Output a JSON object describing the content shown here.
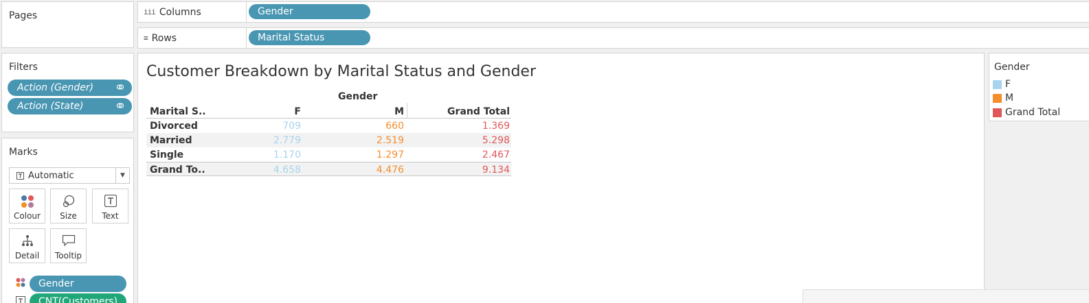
{
  "pages": {
    "title": "Pages"
  },
  "columns": {
    "label": "Columns",
    "icon": "columns-icon",
    "pill": "Gender"
  },
  "rows": {
    "label": "Rows",
    "icon": "rows-icon",
    "pill": "Marital Status"
  },
  "filters": {
    "title": "Filters",
    "items": [
      {
        "label": "Action (Gender)"
      },
      {
        "label": "Action (State)"
      }
    ]
  },
  "marks": {
    "title": "Marks",
    "type": "Automatic",
    "buttons": [
      {
        "label": "Colour",
        "icon": "colour-icon"
      },
      {
        "label": "Size",
        "icon": "size-icon"
      },
      {
        "label": "Text",
        "icon": "text-icon"
      },
      {
        "label": "Detail",
        "icon": "detail-icon"
      },
      {
        "label": "Tooltip",
        "icon": "tooltip-icon"
      }
    ],
    "fields": [
      {
        "label": "Gender",
        "color": "#4996b2",
        "icon": "colour-icon"
      },
      {
        "label": "CNT(Customers)",
        "color": "#20a779",
        "icon": "text-icon"
      }
    ]
  },
  "view": {
    "title": "Customer Breakdown by Marital Status and Gender",
    "column_header": "Gender",
    "row_header": "Marital S..",
    "col_f": "F",
    "col_m": "M",
    "col_gt": "Grand Total",
    "rows": [
      {
        "label": "Divorced",
        "f": "709",
        "m": "660",
        "gt": "1.369"
      },
      {
        "label": "Married",
        "f": "2.779",
        "m": "2.519",
        "gt": "5.298"
      },
      {
        "label": "Single",
        "f": "1.170",
        "m": "1.297",
        "gt": "2.467"
      },
      {
        "label": "Grand To..",
        "f": "4.658",
        "m": "4.476",
        "gt": "9.134"
      }
    ],
    "colors": {
      "f": "#a9d3ec",
      "m": "#f28e2b",
      "gt": "#e15759"
    }
  },
  "legend": {
    "title": "Gender",
    "items": [
      {
        "label": "F",
        "color": "#a9d3ec"
      },
      {
        "label": "M",
        "color": "#f28e2b"
      },
      {
        "label": "Grand Total",
        "color": "#e15759"
      }
    ]
  }
}
